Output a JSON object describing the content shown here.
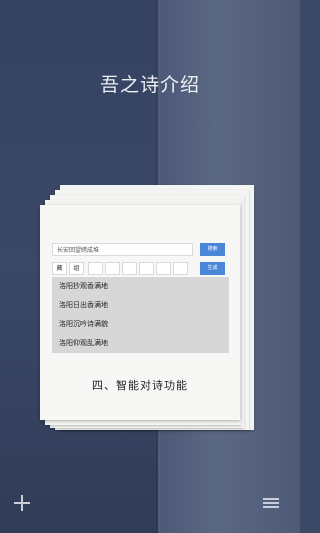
{
  "headline": "吾之诗介绍",
  "search": {
    "value": "长安回望绣成堆",
    "button_label": "搜索"
  },
  "modes": {
    "cells": [
      "藏",
      "组",
      "",
      "",
      "",
      "",
      "",
      ""
    ],
    "button_label": "生成"
  },
  "results": [
    "洛阳抄观香满地",
    "洛阳日出香满地",
    "洛阳沉吟诗满貌",
    "洛阳仰观乱满地"
  ],
  "caption": "四、智能对诗功能",
  "icons": {
    "add": "plus-icon",
    "menu": "hamburger-menu-icon"
  },
  "colors": {
    "background": "#3b4866",
    "accent_button": "#4b86d8",
    "card": "#f7f7f5",
    "results_panel": "#d7d7d7"
  }
}
